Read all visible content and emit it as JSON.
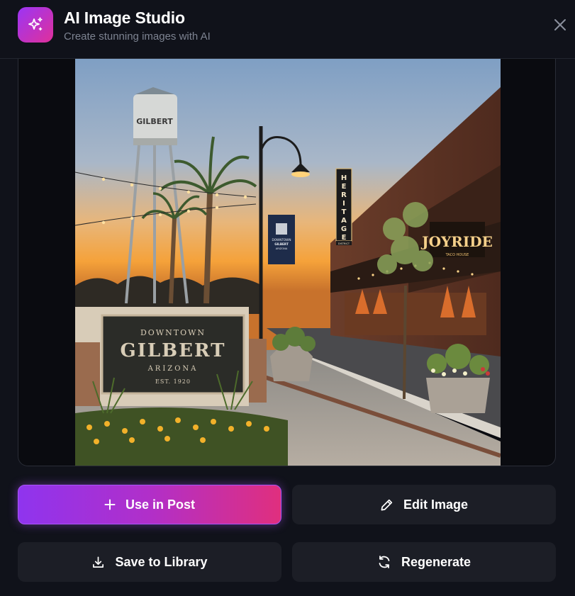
{
  "header": {
    "title": "AI Image Studio",
    "subtitle": "Create stunning images with AI",
    "icon": "sparkles-icon",
    "accent_gradient": [
      "#9b35f5",
      "#e0309a"
    ]
  },
  "image": {
    "alt": "Downtown Gilbert Arizona sign at sunset",
    "sign": {
      "line1": "DOWNTOWN",
      "line2": "GILBERT",
      "line3": "ARIZONA",
      "line4": "EST. 1920"
    },
    "water_tower_text": "GILBERT",
    "banner_text": [
      "DOWNTOWN",
      "GILBERT",
      "ARIZONA"
    ],
    "vertical_sign": [
      "H",
      "E",
      "R",
      "I",
      "T",
      "A",
      "G",
      "E"
    ],
    "vertical_sign_sub": "DISTRICT",
    "storefront_sign": "JOYRIDE",
    "storefront_sub": "TACO HOUSE"
  },
  "actions": {
    "use_in_post": "Use in Post",
    "edit_image": "Edit Image",
    "save_to_library": "Save to Library",
    "regenerate": "Regenerate"
  },
  "colors": {
    "background": "#10121a",
    "button_secondary": "#1c1e26",
    "primary_gradient": [
      "#8f34ee",
      "#e02f7e"
    ]
  }
}
